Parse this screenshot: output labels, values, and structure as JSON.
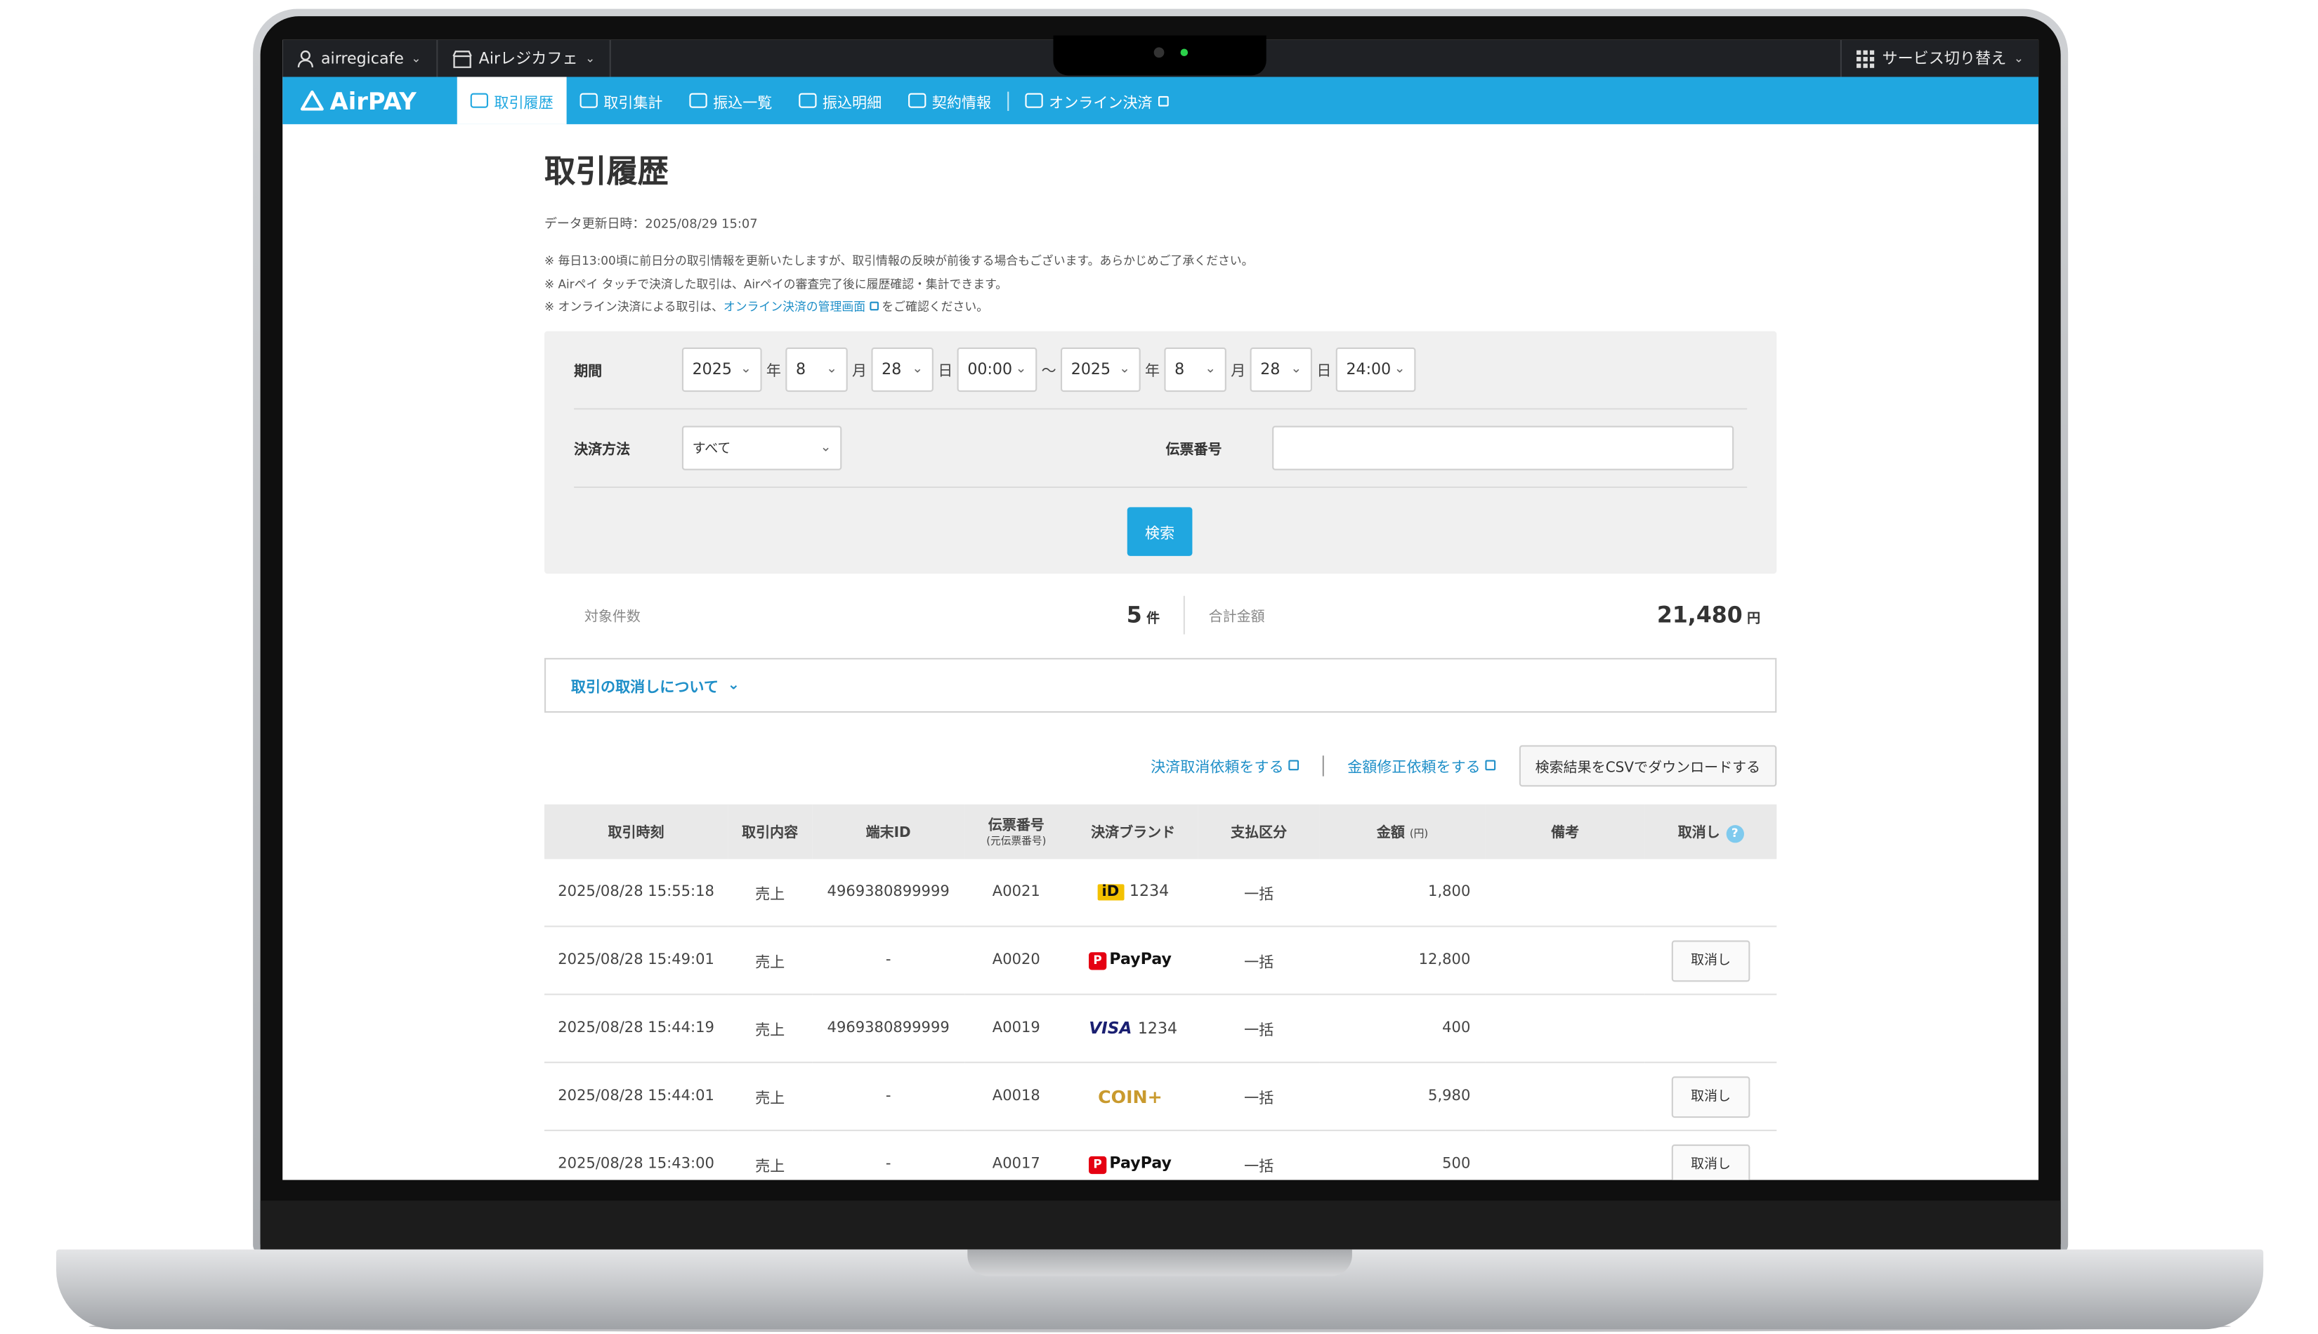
{
  "sysbar": {
    "account": "airregicafe",
    "store": "Airレジカフェ",
    "switch": "サービス切り替え"
  },
  "nav": {
    "logo": "AirPAY",
    "items": [
      "取引履歴",
      "取引集計",
      "振込一覧",
      "振込明細",
      "契約情報",
      "オンライン決済"
    ]
  },
  "page": {
    "title": "取引履歴",
    "updated": "データ更新日時：2025/08/29 15:07",
    "notes": [
      "※  毎日13:00頃に前日分の取引情報を更新いたしますが、取引情報の反映が前後する場合もございます。あらかじめご了承ください。",
      "※  Airペイ タッチで決済した取引は、Airペイの審査完了後に履歴確認・集計できます。",
      "※ オンライン決済による取引は、"
    ],
    "note_link": "オンライン決済の管理画面",
    "note_tail": "をご確認ください。"
  },
  "filter": {
    "period_label": "期間",
    "from": {
      "year": "2025",
      "month": "8",
      "day": "28",
      "time": "00:00"
    },
    "to": {
      "year": "2025",
      "month": "8",
      "day": "28",
      "time": "24:00"
    },
    "unit_year": "年",
    "unit_month": "月",
    "unit_day": "日",
    "tilde": "〜",
    "method_label": "決済方法",
    "method_value": "すべて",
    "slip_label": "伝票番号",
    "slip_value": "",
    "search": "検索"
  },
  "summary": {
    "count_label": "対象件数",
    "count": "5",
    "count_unit": "件",
    "total_label": "合計金額",
    "total": "21,480",
    "total_unit": "円"
  },
  "about": "取引の取消しについて",
  "actions": {
    "cancel_request": "決済取消依頼をする",
    "amount_fix": "金額修正依頼をする",
    "csv": "検索結果をCSVでダウンロードする"
  },
  "table": {
    "headers": [
      "取引時刻",
      "取引内容",
      "端末ID",
      "伝票番号",
      "決済ブランド",
      "支払区分",
      "金額",
      "備考",
      "取消し"
    ],
    "slip_sub": "(元伝票番号)",
    "amount_unit": "(円)",
    "rows": [
      {
        "time": "2025/08/28 15:55:18",
        "type": "売上",
        "terminal": "4969380899999",
        "slip": "A0021",
        "brand": "iD",
        "brand_num": "1234",
        "pay": "一括",
        "amount": "1,800",
        "cancel": ""
      },
      {
        "time": "2025/08/28 15:49:01",
        "type": "売上",
        "terminal": "-",
        "slip": "A0020",
        "brand": "PayPay",
        "brand_num": "",
        "pay": "一括",
        "amount": "12,800",
        "cancel": "取消し"
      },
      {
        "time": "2025/08/28 15:44:19",
        "type": "売上",
        "terminal": "4969380899999",
        "slip": "A0019",
        "brand": "VISA",
        "brand_num": "1234",
        "pay": "一括",
        "amount": "400",
        "cancel": ""
      },
      {
        "time": "2025/08/28 15:44:01",
        "type": "売上",
        "terminal": "-",
        "slip": "A0018",
        "brand": "COIN+",
        "brand_num": "",
        "pay": "一括",
        "amount": "5,980",
        "cancel": "取消し"
      },
      {
        "time": "2025/08/28 15:43:00",
        "type": "売上",
        "terminal": "-",
        "slip": "A0017",
        "brand": "PayPay",
        "brand_num": "",
        "pay": "一括",
        "amount": "500",
        "cancel": "取消し"
      }
    ]
  }
}
